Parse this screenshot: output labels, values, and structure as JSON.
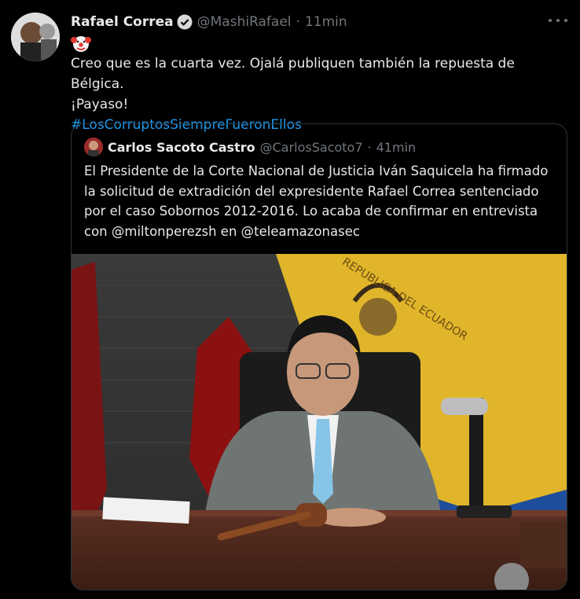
{
  "tweet": {
    "author_name": "Rafael Correa",
    "author_handle": "@MashiRafael",
    "separator": "·",
    "time": "11min",
    "emoji": "🤡",
    "text_line1": "Creo que es la cuarta vez. Ojalá publiquen también la repuesta de Bélgica.",
    "text_line2": "¡Payaso!",
    "hashtag": "#LosCorruptosSiempreFueronEllos"
  },
  "quote": {
    "author_name": "Carlos Sacoto Castro",
    "author_handle": "@CarlosSacoto7",
    "separator": "·",
    "time": "41min",
    "text": "El Presidente de la Corte Nacional de Justicia Iván Saquicela ha firmado la solicitud de extradición del expresidente Rafael Correa sentenciado por el caso Sobornos 2012-2016. Lo acaba de confirmar en entrevista con @miltonperezsh en @teleamazonasec",
    "photo_flag_text": "REPUBLICA DEL ECUADOR"
  },
  "colors": {
    "background": "#000000",
    "text": "#e7e9ea",
    "muted": "#71767b",
    "link": "#1d9bf0",
    "border": "#2f3336",
    "verified": "#d9d9d9"
  }
}
